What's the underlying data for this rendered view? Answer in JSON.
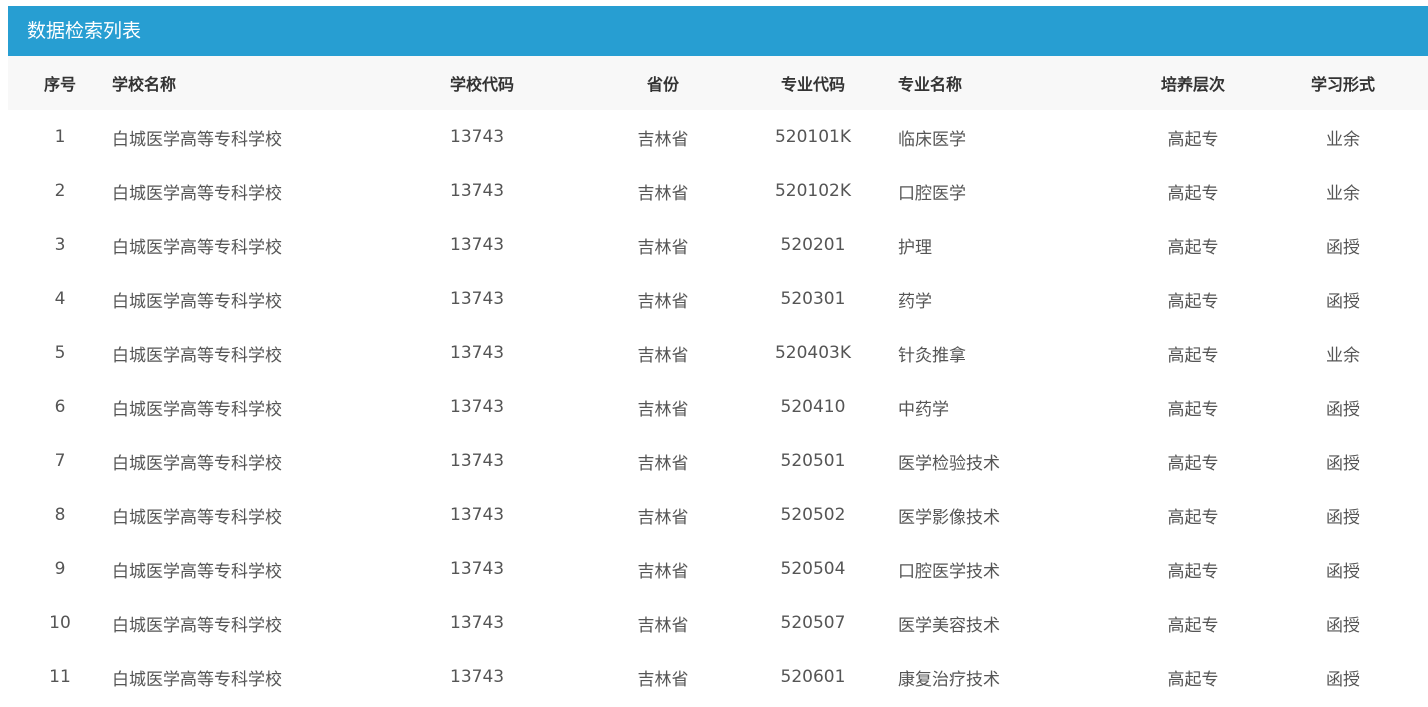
{
  "panel": {
    "title": "数据检索列表"
  },
  "table": {
    "headers": {
      "index": "序号",
      "school_name": "学校名称",
      "school_code": "学校代码",
      "province": "省份",
      "major_code": "专业代码",
      "major_name": "专业名称",
      "level": "培养层次",
      "study_form": "学习形式"
    },
    "rows": [
      {
        "index": "1",
        "school_name": "白城医学高等专科学校",
        "school_code": "13743",
        "province": "吉林省",
        "major_code": "520101K",
        "major_name": "临床医学",
        "level": "高起专",
        "study_form": "业余"
      },
      {
        "index": "2",
        "school_name": "白城医学高等专科学校",
        "school_code": "13743",
        "province": "吉林省",
        "major_code": "520102K",
        "major_name": "口腔医学",
        "level": "高起专",
        "study_form": "业余"
      },
      {
        "index": "3",
        "school_name": "白城医学高等专科学校",
        "school_code": "13743",
        "province": "吉林省",
        "major_code": "520201",
        "major_name": "护理",
        "level": "高起专",
        "study_form": "函授"
      },
      {
        "index": "4",
        "school_name": "白城医学高等专科学校",
        "school_code": "13743",
        "province": "吉林省",
        "major_code": "520301",
        "major_name": "药学",
        "level": "高起专",
        "study_form": "函授"
      },
      {
        "index": "5",
        "school_name": "白城医学高等专科学校",
        "school_code": "13743",
        "province": "吉林省",
        "major_code": "520403K",
        "major_name": "针灸推拿",
        "level": "高起专",
        "study_form": "业余"
      },
      {
        "index": "6",
        "school_name": "白城医学高等专科学校",
        "school_code": "13743",
        "province": "吉林省",
        "major_code": "520410",
        "major_name": "中药学",
        "level": "高起专",
        "study_form": "函授"
      },
      {
        "index": "7",
        "school_name": "白城医学高等专科学校",
        "school_code": "13743",
        "province": "吉林省",
        "major_code": "520501",
        "major_name": "医学检验技术",
        "level": "高起专",
        "study_form": "函授"
      },
      {
        "index": "8",
        "school_name": "白城医学高等专科学校",
        "school_code": "13743",
        "province": "吉林省",
        "major_code": "520502",
        "major_name": "医学影像技术",
        "level": "高起专",
        "study_form": "函授"
      },
      {
        "index": "9",
        "school_name": "白城医学高等专科学校",
        "school_code": "13743",
        "province": "吉林省",
        "major_code": "520504",
        "major_name": "口腔医学技术",
        "level": "高起专",
        "study_form": "函授"
      },
      {
        "index": "10",
        "school_name": "白城医学高等专科学校",
        "school_code": "13743",
        "province": "吉林省",
        "major_code": "520507",
        "major_name": "医学美容技术",
        "level": "高起专",
        "study_form": "函授"
      },
      {
        "index": "11",
        "school_name": "白城医学高等专科学校",
        "school_code": "13743",
        "province": "吉林省",
        "major_code": "520601",
        "major_name": "康复治疗技术",
        "level": "高起专",
        "study_form": "函授"
      }
    ]
  },
  "colors": {
    "header_bar": "#279ed2",
    "table_header_bg": "#f8f8f8",
    "header_text": "#333333",
    "cell_text": "#555555"
  }
}
